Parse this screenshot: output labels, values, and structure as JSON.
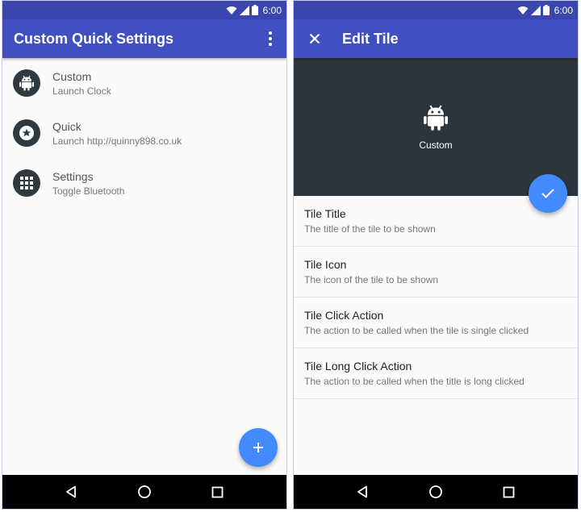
{
  "status_bar": {
    "time": "6:00"
  },
  "colors": {
    "status": "#3a46ad",
    "app_bar": "#4150c0",
    "fab": "#448aff",
    "avatar": "#2f3a40",
    "preview_bg": "#2b353b"
  },
  "left_screen": {
    "title": "Custom Quick Settings",
    "tiles": [
      {
        "title": "Custom",
        "subtitle": "Launch Clock",
        "icon": "android-icon"
      },
      {
        "title": "Quick",
        "subtitle": "Launch http://quinny898.co.uk",
        "icon": "star-circle-icon"
      },
      {
        "title": "Settings",
        "subtitle": "Toggle Bluetooth",
        "icon": "apps-grid-icon"
      }
    ],
    "fab_icon": "plus-icon"
  },
  "right_screen": {
    "title": "Edit Tile",
    "preview_label": "Custom",
    "fab_icon": "check-icon",
    "settings": [
      {
        "title": "Tile Title",
        "subtitle": "The title of the tile to be shown"
      },
      {
        "title": "Tile Icon",
        "subtitle": "The icon of the tile to be shown"
      },
      {
        "title": "Tile Click Action",
        "subtitle": "The action to be called when the tile is single clicked"
      },
      {
        "title": "Tile Long Click Action",
        "subtitle": "The action to be called when the title is long clicked"
      }
    ]
  }
}
